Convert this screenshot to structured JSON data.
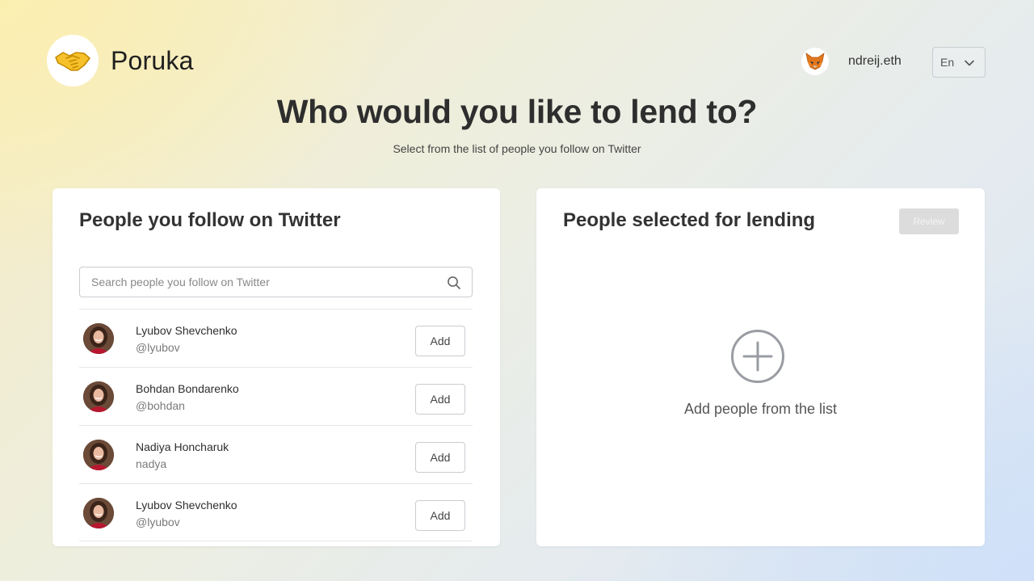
{
  "app": {
    "brand": "Poruka",
    "logo_icon": "handshake-icon"
  },
  "account": {
    "name": "ndreij.eth",
    "avatar_icon": "fox-icon"
  },
  "language": {
    "selected": "En"
  },
  "hero": {
    "title": "Who would you like to lend to?",
    "subtitle": "Select from the list of people you follow on Twitter"
  },
  "following_panel": {
    "title": "People you follow on Twitter",
    "search_placeholder": "Search people you follow on Twitter",
    "add_label": "Add",
    "people": [
      {
        "name": "Lyubov Shevchenko",
        "handle": "@lyubov"
      },
      {
        "name": "Bohdan Bondarenko",
        "handle": "@bohdan"
      },
      {
        "name": "Nadiya Honcharuk",
        "handle": "nadya"
      },
      {
        "name": "Lyubov Shevchenko",
        "handle": "@lyubov"
      }
    ]
  },
  "selected_panel": {
    "title": "People selected for lending",
    "review_label": "Review",
    "empty_text": "Add people from the list"
  },
  "colors": {
    "accent_gray": "#dcdcdc",
    "avatar_shirt": "#b8172f"
  }
}
